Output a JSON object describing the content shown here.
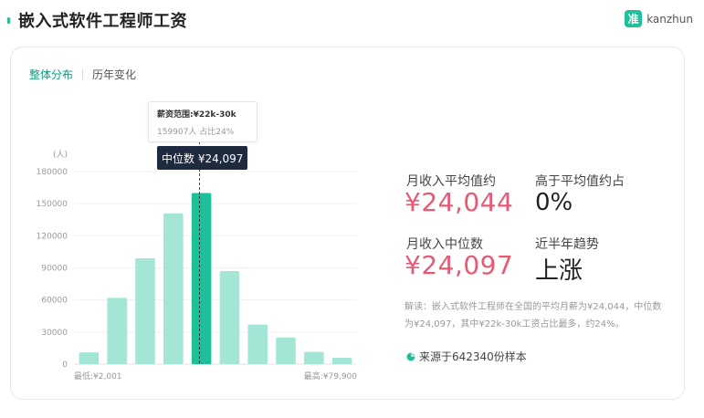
{
  "page": {
    "title": "嵌入式软件工程师工资",
    "brand_logo_char": "准",
    "brand_name": "kanzhun"
  },
  "tabs": [
    {
      "label": "整体分布",
      "active": true
    },
    {
      "label": "历年变化",
      "active": false
    }
  ],
  "tooltip": {
    "title": "薪资范围:¥22k-30k",
    "subtitle": "159907人  占比24%"
  },
  "median_badge": "中位数 ¥24,097",
  "stats": {
    "avg_label": "月收入平均值约",
    "avg_value": "¥24,044",
    "above_avg_label": "高于平均值约占",
    "above_avg_value": "0%",
    "median_label": "月收入中位数",
    "median_value": "¥24,097",
    "trend_label": "近半年趋势",
    "trend_value": "上涨"
  },
  "note": "解读：嵌入式软件工程师在全国的平均月薪为¥24,044，中位数为¥24,097，其中¥22k-30k工资占比最多，约24%。",
  "source": "来源于642340份样本",
  "colors": {
    "accent": "#1fbf9a",
    "bar": "#a3e6d6",
    "bar_highlight": "#1fbf9a",
    "red": "#e75a74",
    "badge": "#1e2a3d"
  },
  "chart_data": {
    "type": "bar",
    "y_unit": "(人)",
    "ylim": [
      0,
      180000
    ],
    "yticks": [
      0,
      30000,
      60000,
      90000,
      120000,
      150000,
      180000
    ],
    "values": [
      11000,
      62000,
      99000,
      141000,
      159907,
      87000,
      37000,
      25000,
      11500,
      6000
    ],
    "highlight_index": 4,
    "x_min_label": "最低:¥2,001",
    "x_max_label": "最高:¥79,900",
    "grid": true
  }
}
